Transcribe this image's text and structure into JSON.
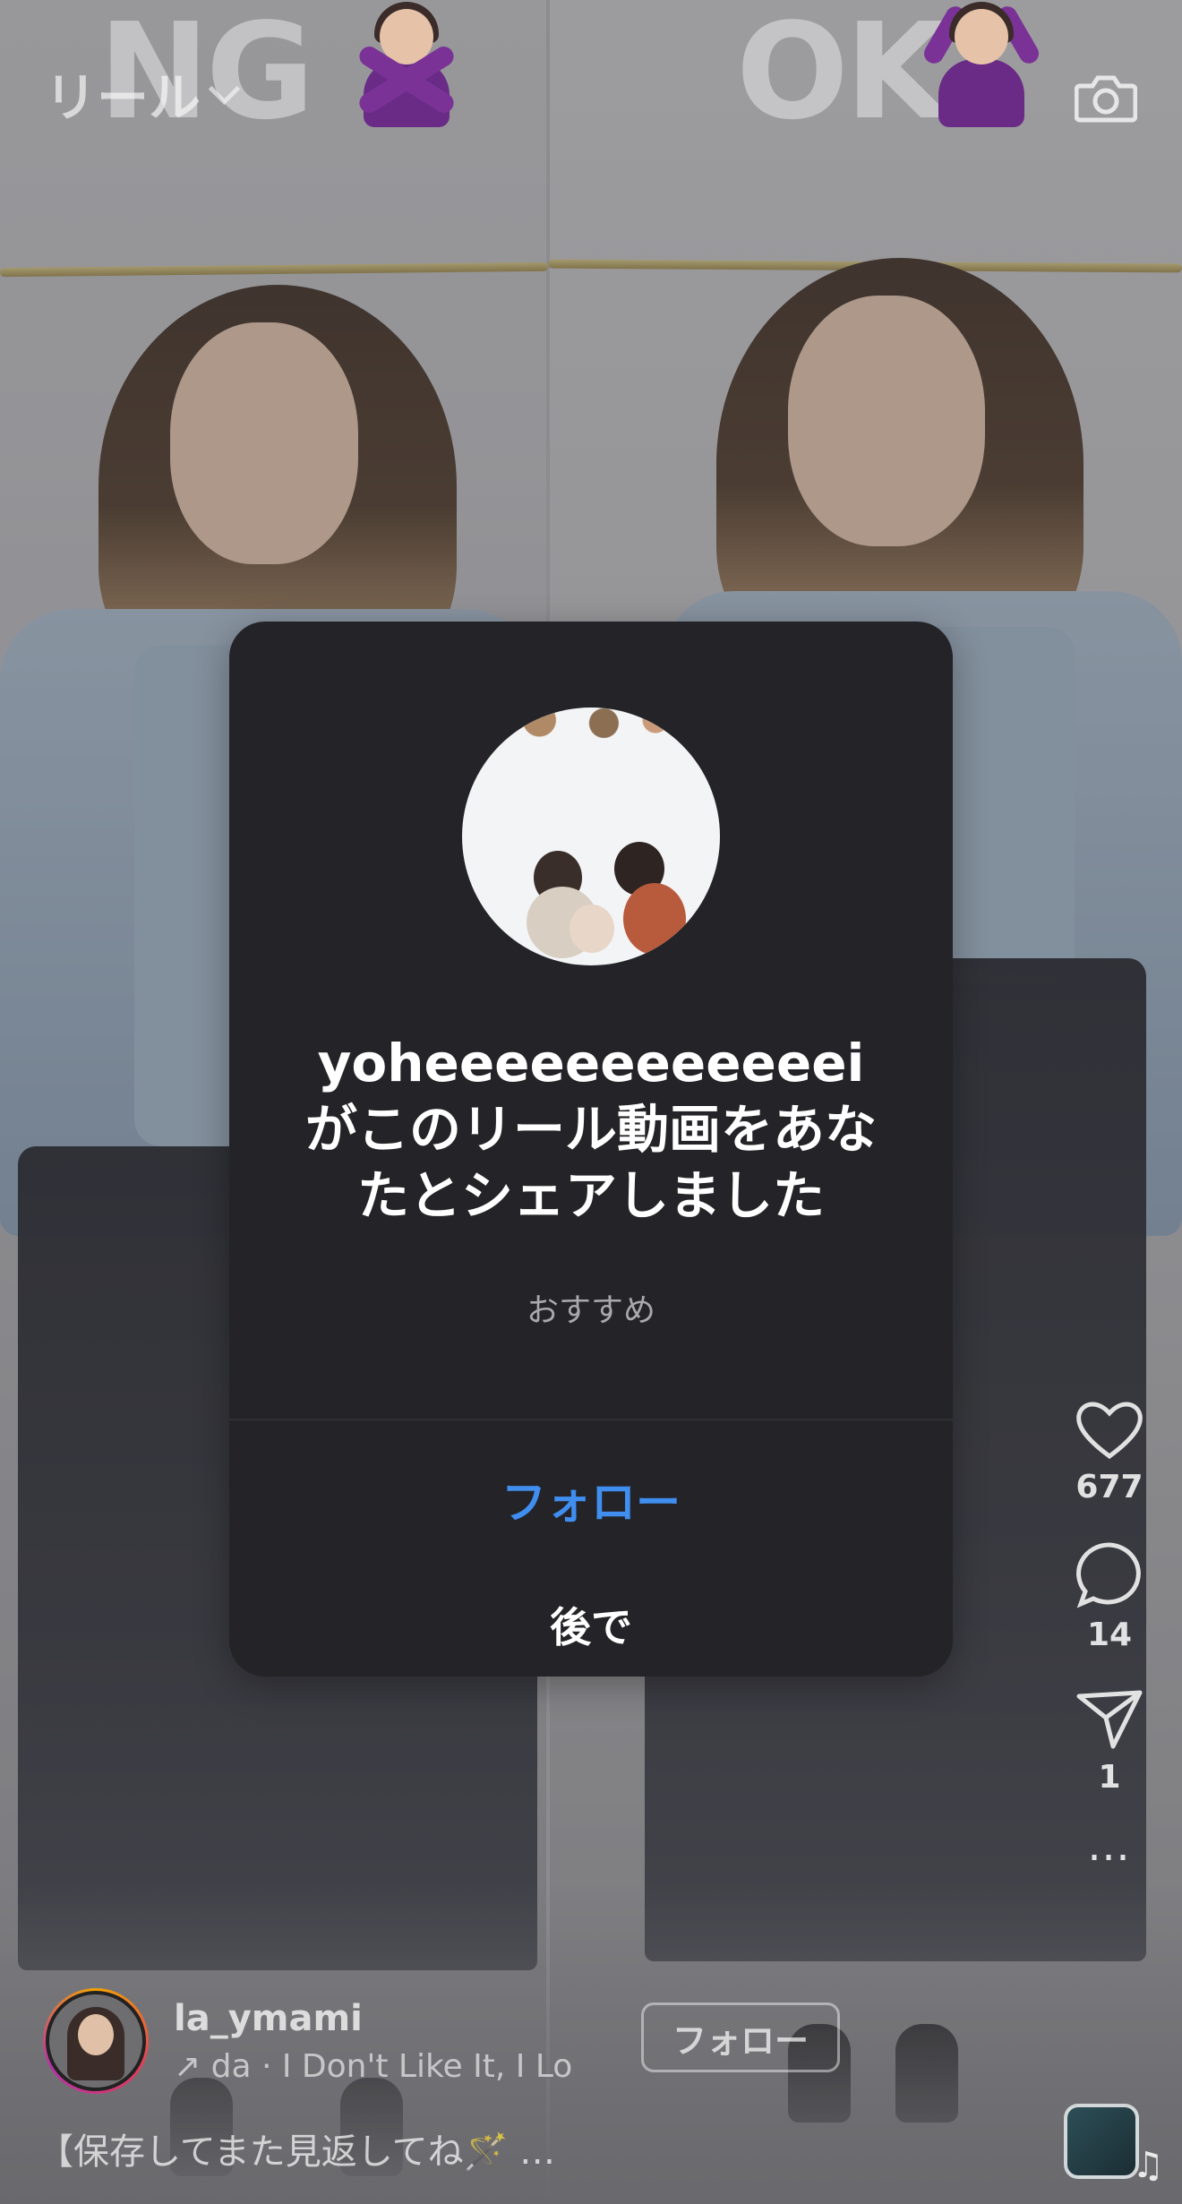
{
  "header": {
    "title": "リール"
  },
  "overlay": {
    "left_label": "NG",
    "right_label": "OK"
  },
  "actions": {
    "likes": "677",
    "comments": "14",
    "shares": "1"
  },
  "author": {
    "username": "la_ymami",
    "audio": "↗ da · I Don't Like It, I Lo",
    "follow_label": "フォロー"
  },
  "caption": "【保存してまた見返してね🪄 …",
  "modal": {
    "title": "yoheeeeeeeeeeeei\nがこのリール動画をあなたとシェアしました",
    "recommend": "おすすめ",
    "follow_label": "フォロー",
    "later_label": "後で"
  },
  "colors": {
    "follow_blue": "#3f8ef0",
    "modal_bg": "#242428"
  }
}
